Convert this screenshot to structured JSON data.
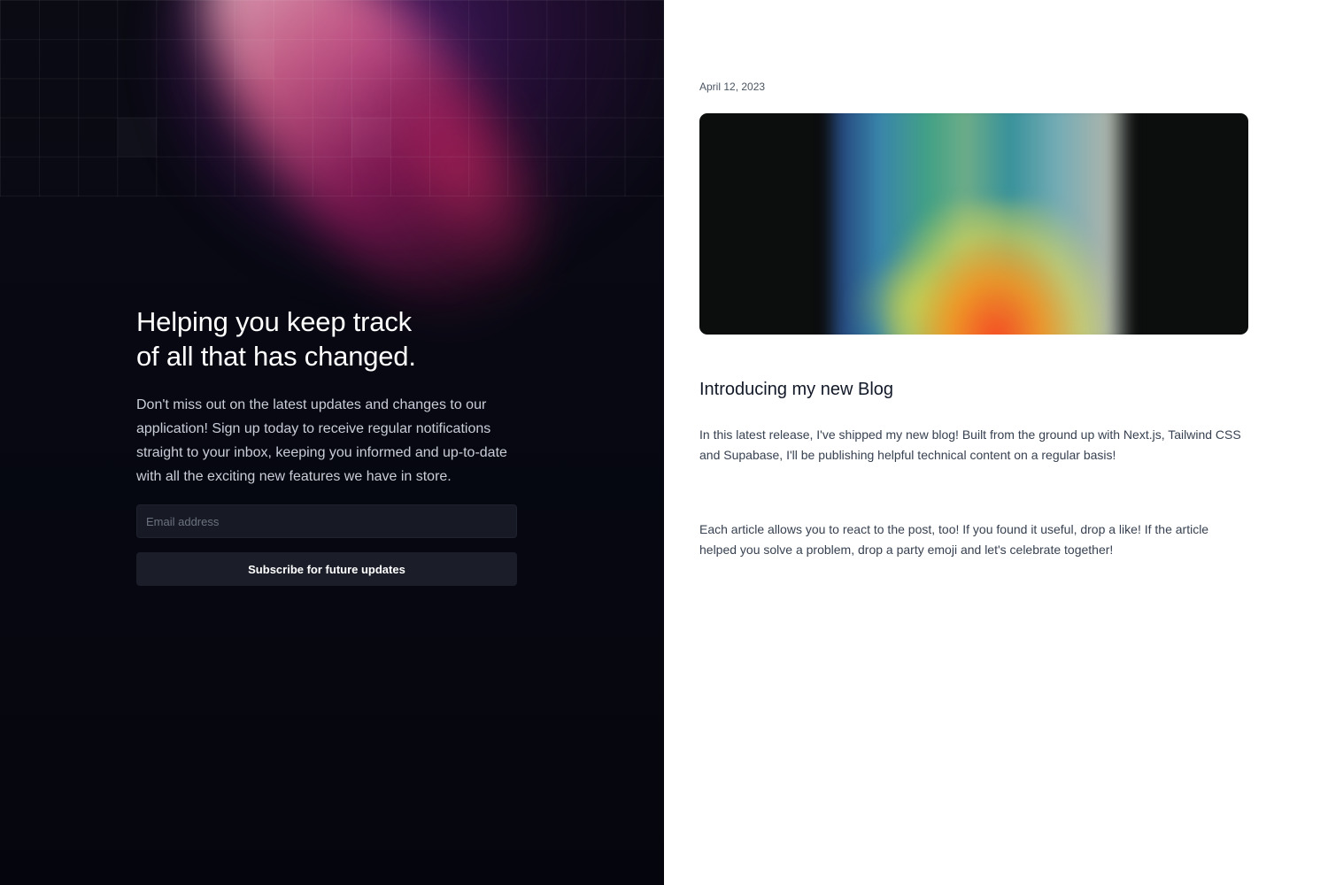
{
  "signup": {
    "title_line1": "Helping you keep track",
    "title_line2": "of all that has changed.",
    "description": "Don't miss out on the latest updates and changes to our application! Sign up today to receive regular notifications straight to your inbox, keeping you informed and up-to-date with all the exciting new features we have in store.",
    "email_placeholder": "Email address",
    "email_value": "",
    "subscribe_label": "Subscribe for future updates"
  },
  "post": {
    "date": "April 12, 2023",
    "title": "Introducing my new Blog",
    "paragraphs": [
      "In this latest release, I've shipped my new blog! Built from the ground up with Next.js, Tailwind CSS and Supabase, I'll be publishing helpful technical content on a regular basis!",
      "Each article allows you to react to the post, too! If you found it useful, drop a like! If the article helped you solve a problem, drop a party emoji and let's celebrate together!"
    ]
  },
  "colors": {
    "left_background": "#070812",
    "input_background": "#171a24",
    "button_background": "#1b1e29",
    "right_background": "#ffffff"
  }
}
